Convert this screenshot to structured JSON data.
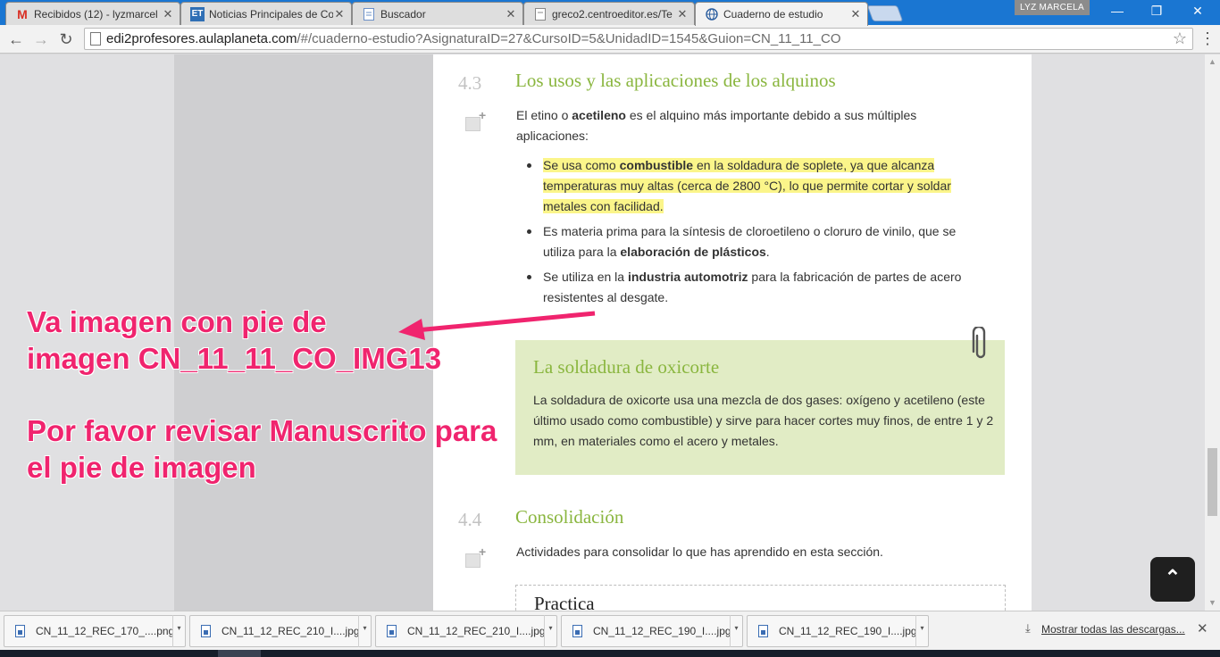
{
  "browser": {
    "tabs": [
      {
        "title": "Recibidos (12) - lyzmarcel",
        "favicon": "gmail-icon",
        "active": false
      },
      {
        "title": "Noticias Principales de Co",
        "favicon": "et-icon",
        "active": false
      },
      {
        "title": "Buscador",
        "favicon": "page-icon",
        "active": false
      },
      {
        "title": "greco2.centroeditor.es/Te",
        "favicon": "page-icon",
        "active": false
      },
      {
        "title": "Cuaderno de estudio",
        "favicon": "globe-icon",
        "active": true
      }
    ],
    "user_badge": "LYZ MARCELA",
    "url_host": "edi2profesores.aulaplaneta.com",
    "url_rest": "/#/cuaderno-estudio?AsignaturaID=27&CursoID=5&UnidadID=1545&Guion=CN_11_11_CO"
  },
  "page": {
    "section_43": {
      "number": "4.3",
      "title": "Los usos y las aplicaciones de los alquinos",
      "intro_pre": "El etino o ",
      "intro_bold": "acetileno",
      "intro_post": " es el alquino más importante debido a sus múltiples aplicaciones:",
      "bullets": [
        {
          "pre": "Se usa como ",
          "bold": "combustible",
          "post": " en la soldadura de soplete, ya que alcanza temperaturas muy altas (cerca de 2800 °C), lo que permite cortar y soldar metales con facilidad."
        },
        {
          "pre": "Es materia prima para la síntesis de cloroetileno o cloruro de vinilo, que se utiliza para la ",
          "bold": "elaboración de plásticos",
          "post": "."
        },
        {
          "pre": "Se utiliza en la ",
          "bold": "industria automotriz",
          "post": " para la fabricación de partes de acero resistentes al desgate."
        }
      ]
    },
    "box": {
      "title": "La soldadura de oxicorte",
      "text": "La soldadura de oxicorte usa una mezcla de dos gases: oxígeno y acetileno (este último usado como combustible) y sirve para hacer cortes muy finos, de entre 1 y 2 mm, en materiales como el acero y metales."
    },
    "section_44": {
      "number": "4.4",
      "title": "Consolidación",
      "text": "Actividades para consolidar lo que has aprendido en esta sección."
    },
    "practice_title": "Practica",
    "to_top_label": "⌃"
  },
  "annotation": {
    "line1": "Va imagen con pie de",
    "line2": "imagen CN_11_11_CO_IMG13",
    "line3": "Por favor revisar Manuscrito para",
    "line4": "el pie de imagen",
    "color": "#f0246e"
  },
  "downloads": {
    "items": [
      "CN_11_12_REC_170_....png",
      "CN_11_12_REC_210_I....jpg",
      "CN_11_12_REC_210_I....jpg",
      "CN_11_12_REC_190_I....jpg",
      "CN_11_12_REC_190_I....jpg"
    ],
    "show_all": "Mostrar todas las descargas..."
  },
  "colors": {
    "accent_green": "#8ab63f",
    "box_green": "#e1ecc5",
    "highlight": "#fbf58a",
    "chrome_blue": "#1a76d2"
  }
}
